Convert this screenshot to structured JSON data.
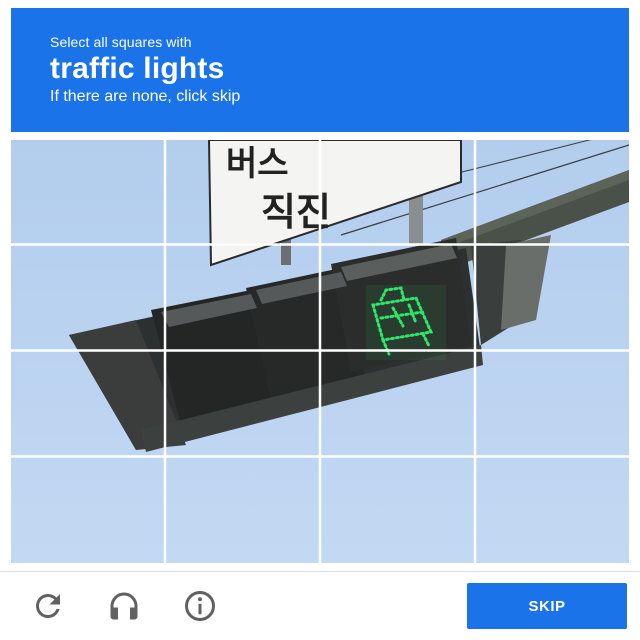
{
  "header": {
    "instruction": "Select all squares with",
    "target": "traffic lights",
    "hint": "If there are none, click skip"
  },
  "image": {
    "sign_text_top": "버스",
    "sign_text_bottom": "직진",
    "signal_state": "green",
    "grid_rows": 4,
    "grid_cols": 4
  },
  "footer": {
    "reload_icon": "reload-icon",
    "audio_icon": "headphones-icon",
    "info_icon": "info-icon",
    "skip_label": "SKIP"
  },
  "colors": {
    "accent": "#1a73e8",
    "sky": "#b8d2f0",
    "signal_green": "#2ee86a",
    "icon_gray": "#616161"
  }
}
